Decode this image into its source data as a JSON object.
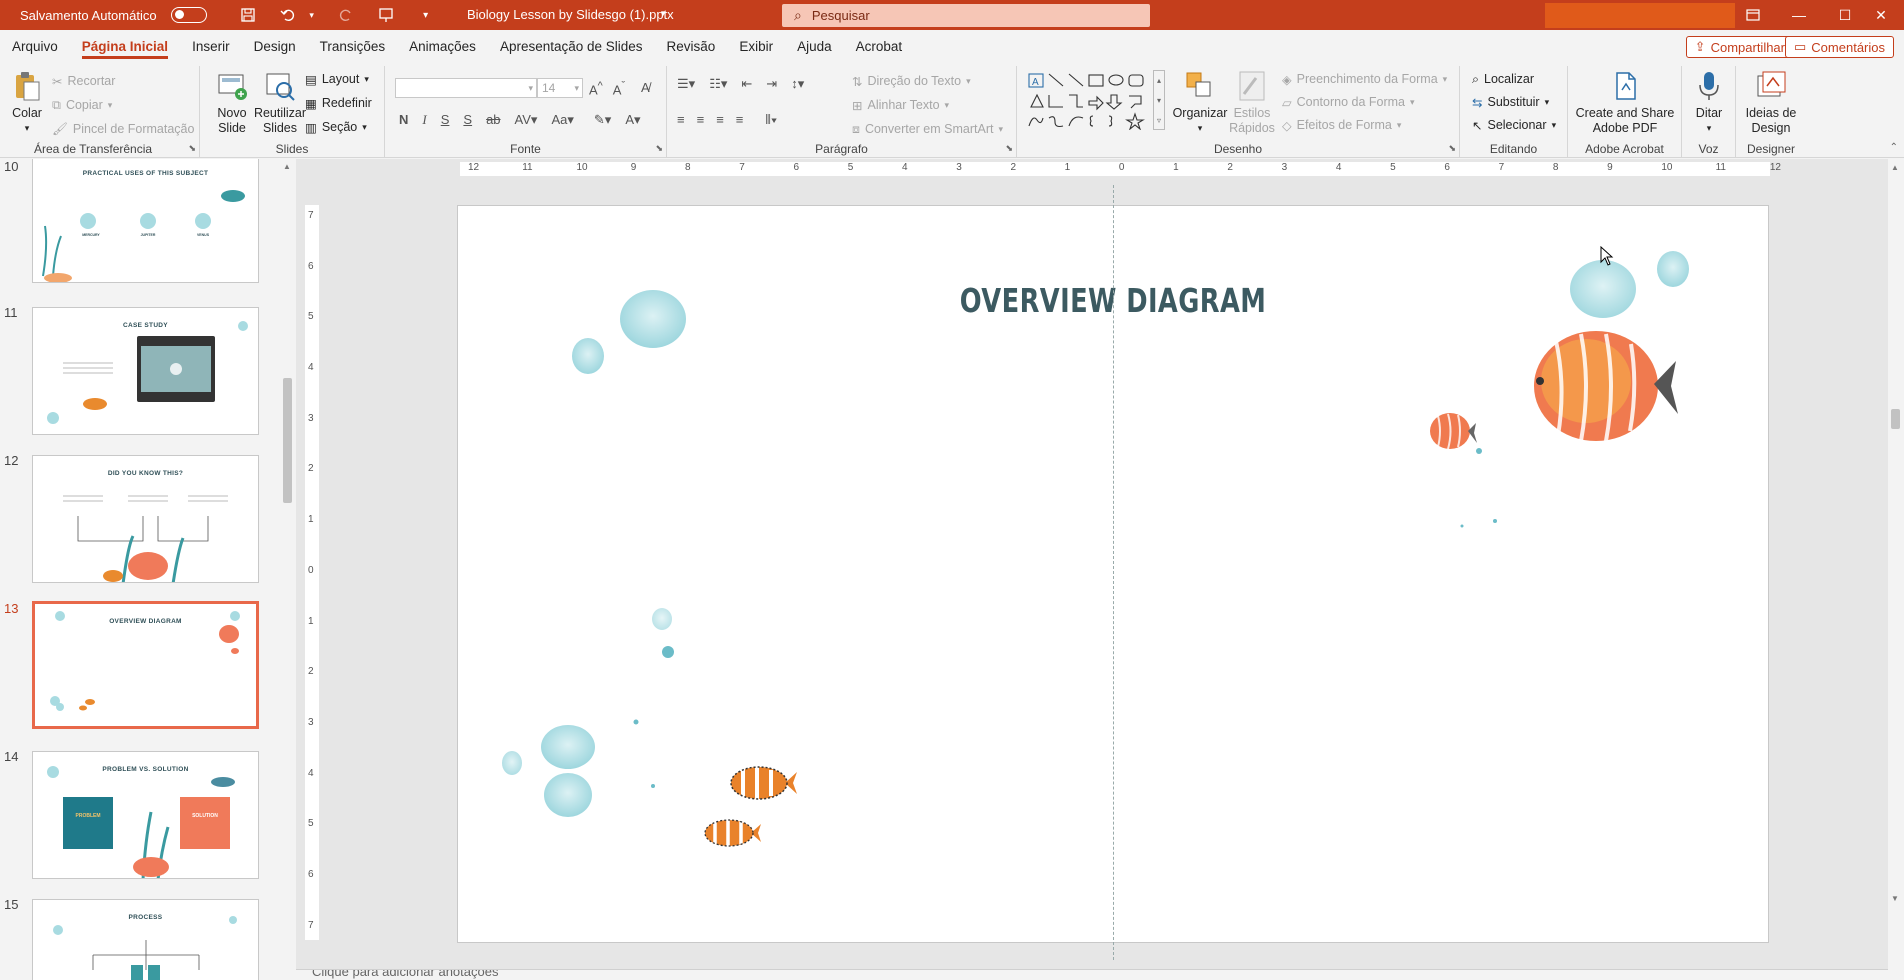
{
  "titlebar": {
    "autosave_label": "Salvamento Automático",
    "doc_title": "Biology Lesson by Slidesgo (1).pptx",
    "search_placeholder": "Pesquisar"
  },
  "menu": {
    "tabs": [
      "Arquivo",
      "Página Inicial",
      "Inserir",
      "Design",
      "Transições",
      "Animações",
      "Apresentação de Slides",
      "Revisão",
      "Exibir",
      "Ajuda",
      "Acrobat"
    ],
    "share_label": "Compartilhar",
    "comments_label": "Comentários"
  },
  "ribbon": {
    "clipboard": {
      "paste": "Colar",
      "cut": "Recortar",
      "copy": "Copiar",
      "format_painter": "Pincel de Formatação",
      "label": "Área de Transferência"
    },
    "slides": {
      "new_slide": "Novo\nSlide",
      "reuse": "Reutilizar\nSlides",
      "layout": "Layout",
      "reset": "Redefinir",
      "section": "Seção",
      "label": "Slides"
    },
    "font": {
      "size": "14",
      "label": "Fonte"
    },
    "paragraph": {
      "text_direction": "Direção do Texto",
      "align_text": "Alinhar Texto",
      "smartart": "Converter em SmartArt",
      "label": "Parágrafo"
    },
    "drawing": {
      "arrange": "Organizar",
      "quick_styles": "Estilos\nRápidos",
      "shape_fill": "Preenchimento da Forma",
      "shape_outline": "Contorno da Forma",
      "shape_effects": "Efeitos de Forma",
      "label": "Desenho"
    },
    "editing": {
      "find": "Localizar",
      "replace": "Substituir",
      "select": "Selecionar",
      "label": "Editando"
    },
    "acrobat": {
      "create_share": "Create and Share\nAdobe PDF",
      "label": "Adobe Acrobat"
    },
    "voice": {
      "dictate": "Ditar",
      "label": "Voz"
    },
    "designer": {
      "ideas": "Ideias de\nDesign",
      "label": "Designer"
    }
  },
  "thumbnails": [
    {
      "num": "10",
      "title": "PRACTICAL USES OF THIS SUBJECT",
      "selected": false
    },
    {
      "num": "11",
      "title": "CASE STUDY",
      "selected": false
    },
    {
      "num": "12",
      "title": "DID YOU KNOW THIS?",
      "selected": false
    },
    {
      "num": "13",
      "title": "OVERVIEW DIAGRAM",
      "selected": true
    },
    {
      "num": "14",
      "title": "PROBLEM VS. SOLUTION",
      "selected": false
    },
    {
      "num": "15",
      "title": "PROCESS",
      "selected": false
    }
  ],
  "thumb_extra": {
    "t10_cols": [
      "MERCURY",
      "JUPITER",
      "VENUS"
    ],
    "t14_left": "PROBLEM",
    "t14_right": "SOLUTION"
  },
  "slide": {
    "title": "OVERVIEW DIAGRAM"
  },
  "notes_placeholder": "Clique para adicionar anotações",
  "ruler": {
    "h_ticks": [
      "12",
      "11",
      "10",
      "9",
      "8",
      "7",
      "6",
      "5",
      "4",
      "3",
      "2",
      "1",
      "0",
      "1",
      "2",
      "3",
      "4",
      "5",
      "6",
      "7",
      "8",
      "9",
      "10",
      "11",
      "12"
    ],
    "v_ticks": [
      "7",
      "6",
      "5",
      "4",
      "3",
      "2",
      "1",
      "0",
      "1",
      "2",
      "3",
      "4",
      "5",
      "6",
      "7"
    ]
  },
  "colors": {
    "accent": "#c43e1c",
    "slide_title": "#3c5a61",
    "selection": "#e8684a",
    "bubble": "#8ccfd8"
  }
}
